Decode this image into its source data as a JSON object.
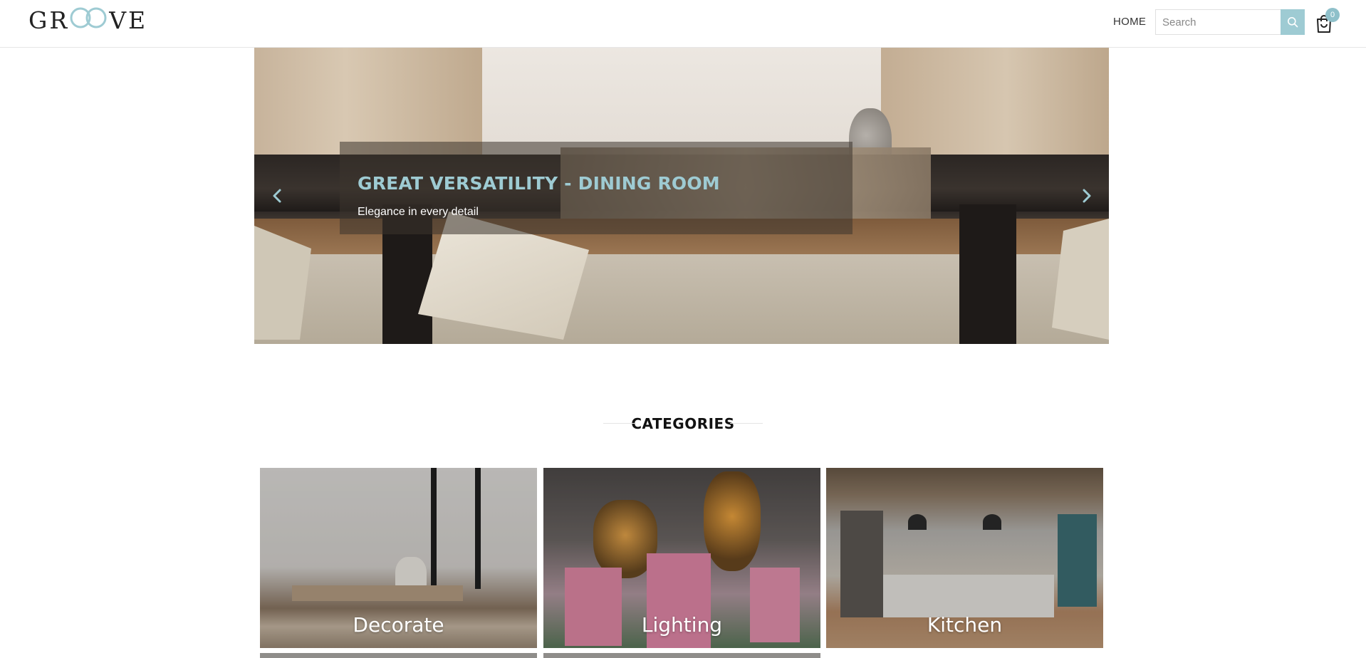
{
  "header": {
    "logo_text": "GROOVE",
    "nav_home": "HOME",
    "search_placeholder": "Search",
    "search_value": "",
    "cart_count": "0",
    "search_icon": "search-icon",
    "cart_icon": "shopping-bag-icon"
  },
  "hero": {
    "title": "GREAT VERSATILITY - DINING ROOM",
    "subtitle": "Elegance in every detail",
    "prev_icon": "chevron-left-icon",
    "next_icon": "chevron-right-icon"
  },
  "categories": {
    "heading": "CATEGORIES",
    "items": [
      {
        "label": "Decorate"
      },
      {
        "label": "Lighting"
      },
      {
        "label": "Kitchen"
      }
    ]
  },
  "colors": {
    "accent": "#9ecbd3",
    "badge": "#8fc0ca"
  }
}
